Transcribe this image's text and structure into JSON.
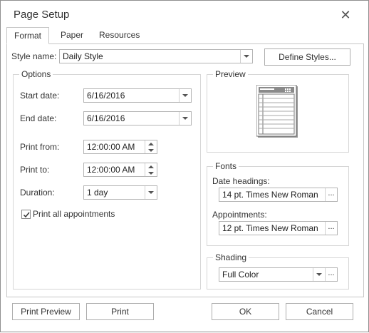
{
  "window": {
    "title": "Page Setup",
    "close_icon": "close-icon"
  },
  "tabs": [
    {
      "label": "Format",
      "active": true
    },
    {
      "label": "Paper",
      "active": false
    },
    {
      "label": "Resources",
      "active": false
    }
  ],
  "style": {
    "label": "Style name:",
    "value": "Daily Style",
    "define_button": "Define Styles..."
  },
  "options": {
    "title": "Options",
    "start_date_label": "Start date:",
    "start_date": "6/16/2016",
    "end_date_label": "End date:",
    "end_date": "6/16/2016",
    "print_from_label": "Print from:",
    "print_from": "12:00:00 AM",
    "print_to_label": "Print to:",
    "print_to": "12:00:00 AM",
    "duration_label": "Duration:",
    "duration": "1 day",
    "print_all_label": "Print all appointments",
    "print_all_checked": true
  },
  "preview": {
    "title": "Preview"
  },
  "fonts": {
    "title": "Fonts",
    "date_headings_label": "Date headings:",
    "date_headings_value": "14 pt. Times New Roman",
    "appointments_label": "Appointments:",
    "appointments_value": "12 pt. Times New Roman",
    "ellipsis": "..."
  },
  "shading": {
    "title": "Shading",
    "value": "Full Color",
    "ellipsis": "..."
  },
  "footer": {
    "print_preview": "Print Preview",
    "print": "Print",
    "ok": "OK",
    "cancel": "Cancel"
  },
  "colors": {
    "border": "#c6c6c6",
    "text": "#333333",
    "preview_header": "#8a8a8a"
  }
}
